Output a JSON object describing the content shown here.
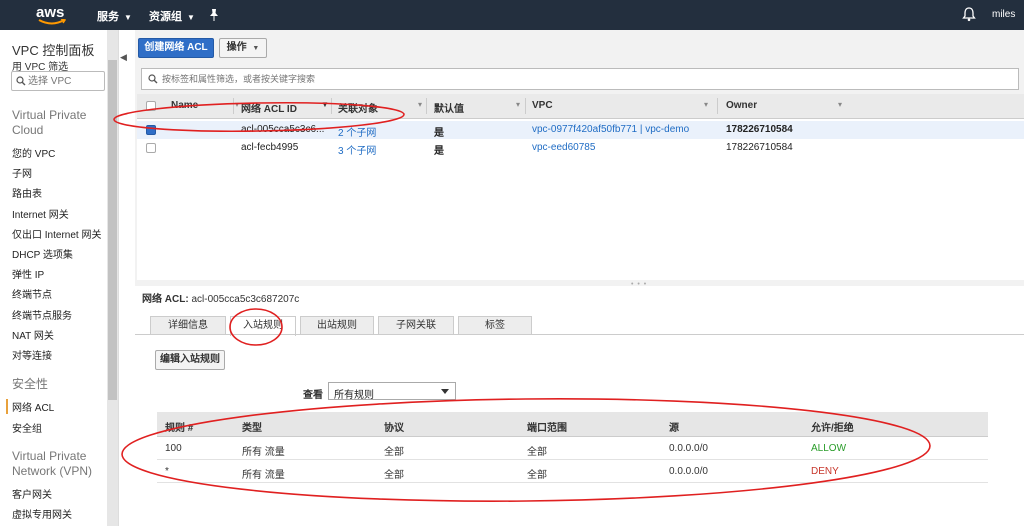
{
  "nav": {
    "logo_text": "aws",
    "services": "服务",
    "resource_groups": "资源组",
    "user": "miles",
    "icons": [
      "pin-icon",
      "bell-icon",
      "caret-down-icon"
    ]
  },
  "sidebar": {
    "title": "VPC 控制面板",
    "filter_label": "用 VPC 筛选",
    "search_placeholder": "选择 VPC",
    "sections": [
      {
        "title": "Virtual Private Cloud",
        "items": [
          "您的 VPC",
          "子网",
          "路由表",
          "Internet 网关",
          "仅出口 Internet 网关",
          "DHCP 选项集",
          "弹性 IP",
          "终端节点",
          "终端节点服务",
          "NAT 网关",
          "对等连接"
        ]
      },
      {
        "title": "安全性",
        "items": [
          "网络 ACL",
          "安全组"
        ]
      },
      {
        "title": "Virtual Private Network (VPN)",
        "items": [
          "客户网关",
          "虚拟专用网关"
        ]
      }
    ],
    "active_item": "网络 ACL"
  },
  "toolbar": {
    "create_label": "创建网络 ACL",
    "action_label": "操作"
  },
  "filter": {
    "placeholder": "按标签和属性筛选，或者按关键字搜索"
  },
  "acl_table": {
    "columns": [
      "Name",
      "网络 ACL ID",
      "关联对象",
      "默认值",
      "VPC",
      "Owner"
    ],
    "rows": [
      {
        "name": "",
        "acl_id": "acl-005cca5c3c6...",
        "associated": "2 个子网",
        "default": "是",
        "vpc": "vpc-0977f420af50fb771 | vpc-demo",
        "owner": "178226710584",
        "selected": true
      },
      {
        "name": "",
        "acl_id": "acl-fecb4995",
        "associated": "3 个子网",
        "default": "是",
        "vpc": "vpc-eed60785",
        "owner": "178226710584",
        "selected": false
      }
    ]
  },
  "detail": {
    "acl_label": "网络 ACL:",
    "acl_value": "acl-005cca5c3c687207c",
    "tabs": [
      "详细信息",
      "入站规则",
      "出站规则",
      "子网关联",
      "标签"
    ],
    "active_tab": "入站规则",
    "edit_button": "编辑入站规则",
    "view_label": "查看",
    "view_value": "所有规则"
  },
  "rules_table": {
    "columns": [
      "规则 #",
      "类型",
      "协议",
      "端口范围",
      "源",
      "允许/拒绝"
    ],
    "rows": [
      {
        "rule": "100",
        "type": "所有 流量",
        "protocol": "全部",
        "port": "全部",
        "source": "0.0.0.0/0",
        "action": "ALLOW"
      },
      {
        "rule": "*",
        "type": "所有 流量",
        "protocol": "全部",
        "port": "全部",
        "source": "0.0.0.0/0",
        "action": "DENY"
      }
    ]
  },
  "colors": {
    "nav_bg": "#232f3e",
    "primary": "#2f6ec7",
    "link": "#1f6cc4",
    "allow": "#2a9d2a",
    "deny": "#c7362b",
    "annotation": "#e02020",
    "sidebar_accent": "#e8a13c"
  }
}
